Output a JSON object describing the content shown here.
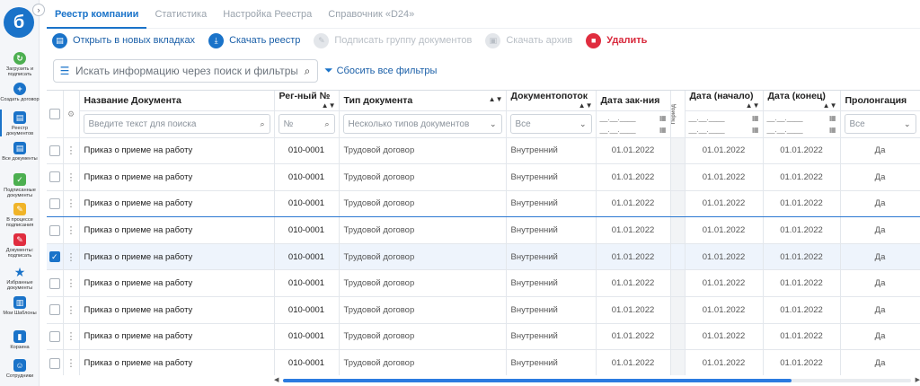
{
  "sidebar": {
    "logo_text": "б",
    "items": [
      {
        "label": "Загрузить и подписать",
        "icon": "upload-sign-icon",
        "color": "#4caf50"
      },
      {
        "label": "Создать договор",
        "icon": "plus-icon",
        "color": "#1a73c9"
      },
      {
        "label": "Реестр документов",
        "icon": "registry-icon",
        "color": "#1a73c9"
      },
      {
        "label": "Все документы",
        "icon": "documents-icon",
        "color": "#1a73c9"
      },
      {
        "label": "Подписанные документы",
        "icon": "signed-doc-icon",
        "color": "#4caf50"
      },
      {
        "label": "В процессе подписания",
        "icon": "in-progress-doc-icon",
        "color": "#f0b429"
      },
      {
        "label": "Документы: подписать",
        "icon": "to-sign-doc-icon",
        "color": "#e02d3f"
      },
      {
        "label": "Избранные документы",
        "icon": "star-icon",
        "color": "#1a73c9"
      },
      {
        "label": "Мои Шаблоны",
        "icon": "templates-icon",
        "color": "#1a73c9"
      },
      {
        "label": "Корзина",
        "icon": "trash-icon",
        "color": "#1a73c9"
      },
      {
        "label": "Сотрудники",
        "icon": "employees-icon",
        "color": "#1a73c9"
      }
    ]
  },
  "tabs": [
    "Реестр компании",
    "Статистика",
    "Настройка Реестра",
    "Справочник «D24»"
  ],
  "toolbar": {
    "open_tabs": "Открыть в новых вкладках",
    "download": "Скачать реестр",
    "sign_group": "Подписать группу документов",
    "download_archive": "Скачать архив",
    "delete": "Удалить"
  },
  "search": {
    "placeholder": "Искать информацию через поиск и фильтры",
    "reset_label": "Сбосить все фильтры"
  },
  "table": {
    "columns": {
      "name": "Название Документа",
      "reg": "Рег-ный №",
      "type": "Тип документа",
      "flow": "Документопоток",
      "date_sign": "Дата зак-ния",
      "period": "Период",
      "date_start": "Дата (начало)",
      "date_end": "Дата (конец)",
      "prolong": "Пролонгация"
    },
    "filters": {
      "name_placeholder": "Введите текст для поиска",
      "reg_placeholder": "№",
      "type_placeholder": "Несколько типов документов",
      "flow_value": "Все",
      "prolong_value": "Все",
      "date_placeholder": "__.__.____"
    },
    "rows": [
      {
        "name": "Приказ о приеме на работу",
        "reg": "010-0001",
        "type": "Трудовой договор",
        "flow": "Внутренний",
        "date_sign": "01.01.2022",
        "date_start": "01.01.2022",
        "date_end": "01.01.2022",
        "prolong": "Да",
        "checked": false
      },
      {
        "name": "Приказ о приеме на работу",
        "reg": "010-0001",
        "type": "Трудовой договор",
        "flow": "Внутренний",
        "date_sign": "01.01.2022",
        "date_start": "01.01.2022",
        "date_end": "01.01.2022",
        "prolong": "Да",
        "checked": false
      },
      {
        "name": "Приказ о приеме на работу",
        "reg": "010-0001",
        "type": "Трудовой договор",
        "flow": "Внутренний",
        "date_sign": "01.01.2022",
        "date_start": "01.01.2022",
        "date_end": "01.01.2022",
        "prolong": "Да",
        "checked": false
      },
      {
        "name": "Приказ о приеме на работу",
        "reg": "010-0001",
        "type": "Трудовой договор",
        "flow": "Внутренний",
        "date_sign": "01.01.2022",
        "date_start": "01.01.2022",
        "date_end": "01.01.2022",
        "prolong": "Да",
        "checked": false
      },
      {
        "name": "Приказ о приеме на работу",
        "reg": "010-0001",
        "type": "Трудовой договор",
        "flow": "Внутренний",
        "date_sign": "01.01.2022",
        "date_start": "01.01.2022",
        "date_end": "01.01.2022",
        "prolong": "Да",
        "checked": true
      },
      {
        "name": "Приказ о приеме на работу",
        "reg": "010-0001",
        "type": "Трудовой договор",
        "flow": "Внутренний",
        "date_sign": "01.01.2022",
        "date_start": "01.01.2022",
        "date_end": "01.01.2022",
        "prolong": "Да",
        "checked": false
      },
      {
        "name": "Приказ о приеме на работу",
        "reg": "010-0001",
        "type": "Трудовой договор",
        "flow": "Внутренний",
        "date_sign": "01.01.2022",
        "date_start": "01.01.2022",
        "date_end": "01.01.2022",
        "prolong": "Да",
        "checked": false
      },
      {
        "name": "Приказ о приеме на работу",
        "reg": "010-0001",
        "type": "Трудовой договор",
        "flow": "Внутренний",
        "date_sign": "01.01.2022",
        "date_start": "01.01.2022",
        "date_end": "01.01.2022",
        "prolong": "Да",
        "checked": false
      },
      {
        "name": "Приказ о приеме на работу",
        "reg": "010-0001",
        "type": "Трудовой договор",
        "flow": "Внутренний",
        "date_sign": "01.01.2022",
        "date_start": "01.01.2022",
        "date_end": "01.01.2022",
        "prolong": "Да",
        "checked": false
      }
    ]
  },
  "colors": {
    "accent": "#1a73c9",
    "danger": "#e02d3f"
  }
}
